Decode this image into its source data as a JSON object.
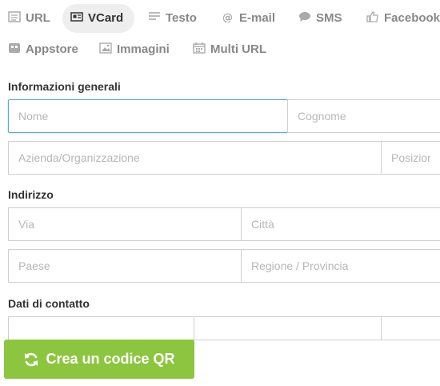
{
  "tabs": [
    {
      "label": "URL",
      "icon": "document-icon"
    },
    {
      "label": "VCard",
      "icon": "id-card-icon",
      "active": true
    },
    {
      "label": "Testo",
      "icon": "text-lines-icon"
    },
    {
      "label": "E-mail",
      "icon": "at-sign-icon"
    },
    {
      "label": "SMS",
      "icon": "chat-bubble-icon"
    },
    {
      "label": "Facebook",
      "icon": "thumbs-up-icon"
    },
    {
      "label": "Appstore",
      "icon": "app-icon"
    },
    {
      "label": "Immagini",
      "icon": "image-icon"
    },
    {
      "label": "Multi URL",
      "icon": "calendar-icon"
    }
  ],
  "sections": {
    "general": "Informazioni generali",
    "address": "Indirizzo",
    "contact": "Dati di contatto"
  },
  "fields": {
    "first_name": "Nome",
    "last_name": "Cognome",
    "company": "Azienda/Organizzazione",
    "position": "Posizione",
    "street": "Via",
    "city": "Città",
    "country": "Paese",
    "region": "Regione / Provincia"
  },
  "submit_label": "Crea un codice QR",
  "colors": {
    "accent": "#8cc63f",
    "focus": "#5aa9dc"
  }
}
